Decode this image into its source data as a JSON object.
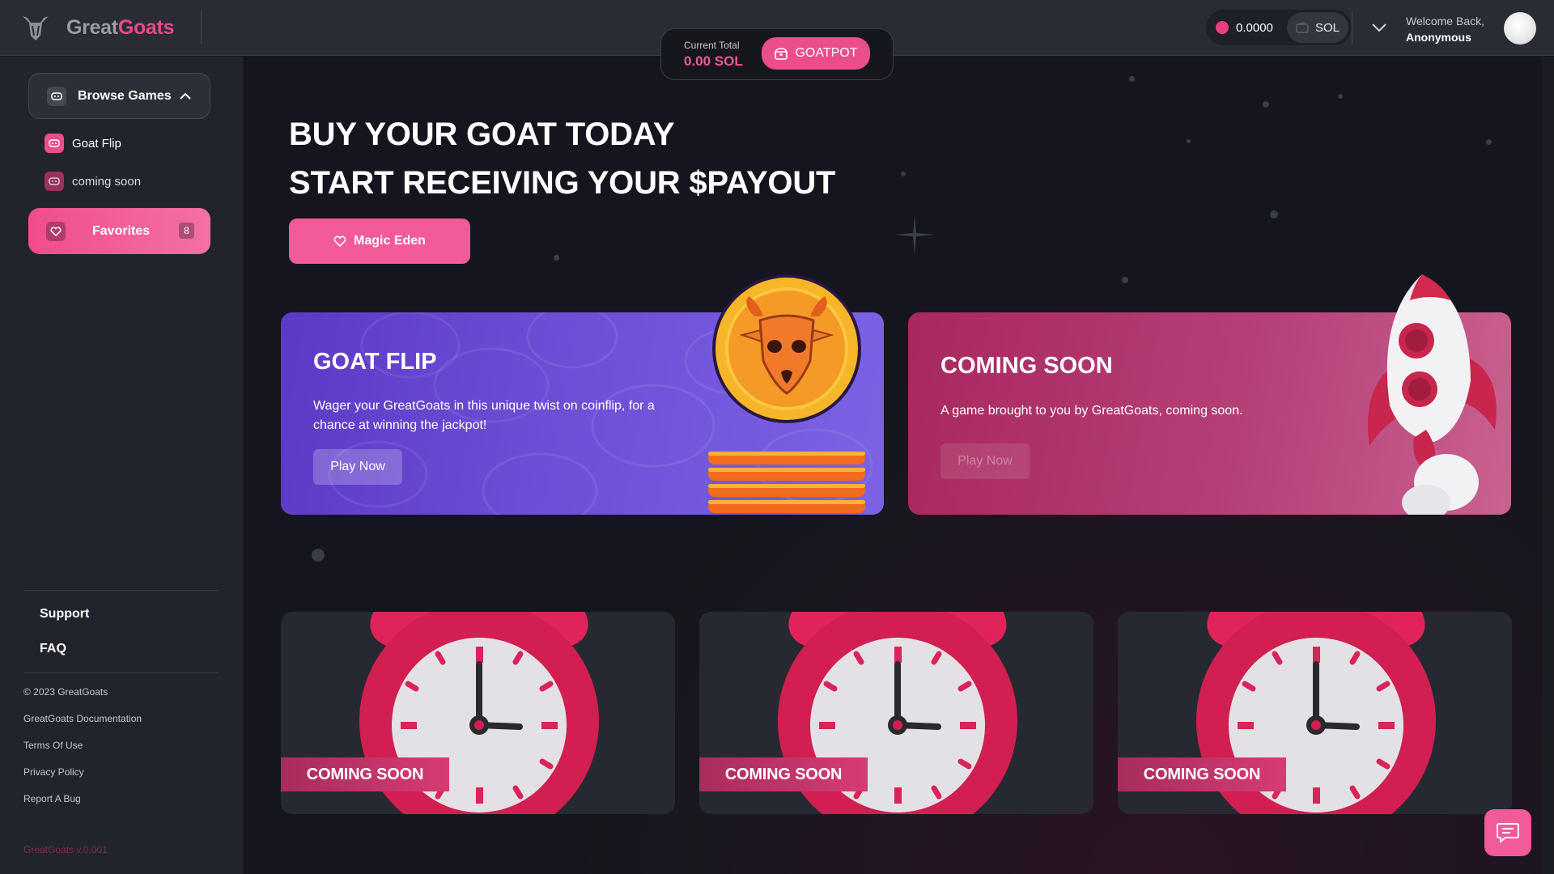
{
  "header": {
    "logo_text_a": "Great",
    "logo_text_b": "Goats",
    "jackpot_label": "Current Total",
    "jackpot_value": "0.00 SOL",
    "goatpot_label": "GOATPOT",
    "balance": "0.0000",
    "currency": "SOL",
    "welcome": "Welcome Back,",
    "username": "Anonymous"
  },
  "sidebar": {
    "browse_label": "Browse Games",
    "items": [
      {
        "label": "Goat Flip"
      },
      {
        "label": "coming soon"
      }
    ],
    "favorites_label": "Favorites",
    "favorites_count": "8",
    "support": "Support",
    "faq": "FAQ",
    "copyright": "© 2023 GreatGoats",
    "links": [
      "GreatGoats Documentation",
      "Terms Of Use",
      "Privacy Policy",
      "Report A Bug"
    ],
    "version": "GreatGoats v.0.001"
  },
  "hero": {
    "line1": "BUY YOUR GOAT TODAY",
    "line2": "START RECEIVING YOUR $PAYOUT",
    "button": "Magic Eden"
  },
  "cards": [
    {
      "title": "GOAT FLIP",
      "desc": "Wager your GreatGoats in this unique twist on coinflip, for a chance at winning the jackpot!",
      "button": "Play Now"
    },
    {
      "title": "COMING SOON",
      "desc": "A game brought to you by GreatGoats, coming soon.",
      "button": "Play Now"
    }
  ],
  "small_cards": [
    {
      "tag": "COMING SOON"
    },
    {
      "tag": "COMING SOON"
    },
    {
      "tag": "COMING SOON"
    }
  ],
  "colors": {
    "accent": "#ec4d8c",
    "background": "#15161d",
    "sidebar": "#22242c",
    "flip_card": "#6d4ed6",
    "soon_card": "#b63f78"
  }
}
